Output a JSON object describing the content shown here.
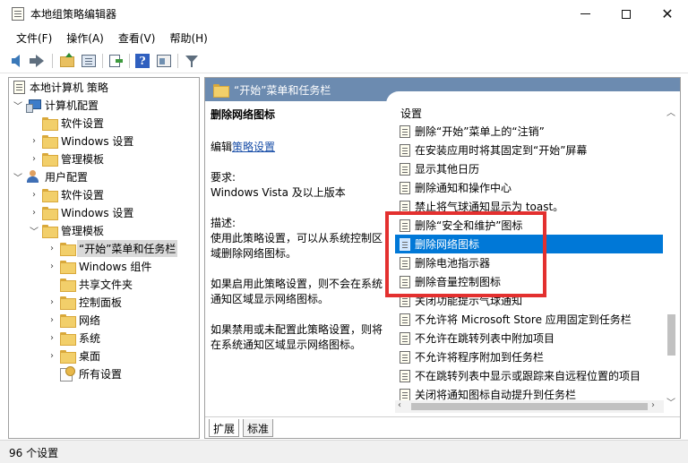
{
  "window": {
    "title": "本地组策略编辑器",
    "controls": {
      "minimize": "",
      "maximize": "",
      "close": "✕"
    }
  },
  "menu": [
    "文件(F)",
    "操作(A)",
    "查看(V)",
    "帮助(H)"
  ],
  "toolbar": [
    "back-icon",
    "forward-icon",
    "up-folder-icon",
    "show-tree-icon",
    "export-icon",
    "help-icon",
    "properties-icon",
    "filter-icon"
  ],
  "tree": {
    "root": "本地计算机 策略",
    "computer": "计算机配置",
    "computer_children": [
      "软件设置",
      "Windows 设置",
      "管理模板"
    ],
    "user": "用户配置",
    "user_children": [
      "软件设置",
      "Windows 设置",
      "管理模板"
    ],
    "admin_children": [
      "“开始”菜单和任务栏",
      "Windows 组件",
      "共享文件夹",
      "控制面板",
      "网络",
      "系统",
      "桌面",
      "所有设置"
    ]
  },
  "header": {
    "title": "“开始”菜单和任务栏"
  },
  "description": {
    "title": "删除网络图标",
    "edit_prefix": "编辑",
    "edit_link": "策略设置",
    "req_label": "要求:",
    "req_value": "Windows Vista 及以上版本",
    "desc_label": "描述:",
    "desc_text": "使用此策略设置，可以从系统控制区域删除网络图标。",
    "enabled_text": "如果启用此策略设置，则不会在系统通知区域显示网络图标。",
    "disabled_text": "如果禁用或未配置此策略设置，则将在系统通知区域显示网络图标。"
  },
  "list": {
    "header": "设置",
    "items": [
      "删除“开始”菜单上的“注销”",
      "在安装应用时将其固定到“开始”屏幕",
      "显示其他日历",
      "删除通知和操作中心",
      "禁止将气球通知显示为 toast。",
      "删除“安全和维护”图标",
      "删除网络图标",
      "删除电池指示器",
      "删除音量控制图标",
      "关闭功能提示气球通知",
      "不允许将 Microsoft Store 应用固定到任务栏",
      "不允许在跳转列表中附加项目",
      "不允许将程序附加到任务栏",
      "不在跳转列表中显示或跟踪来自远程位置的项目",
      "关闭将通知图标自动提升到任务栏"
    ],
    "selected_index": 6
  },
  "tabs": [
    "扩展",
    "标准"
  ],
  "status": "96 个设置",
  "colors": {
    "header_bg": "#6c8bb0",
    "selection": "#0078d7",
    "highlight_box": "#e3302f"
  }
}
